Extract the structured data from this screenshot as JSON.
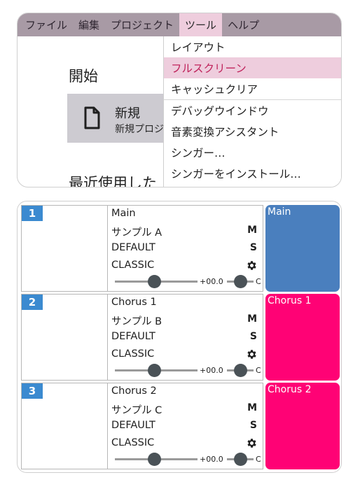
{
  "menubar": {
    "items": [
      "ファイル",
      "編集",
      "プロジェクト",
      "ツール",
      "ヘルプ"
    ],
    "active_index": 3
  },
  "start_page": {
    "heading": "開始",
    "new_card": {
      "title": "新規",
      "subtitle": "新規プロジ",
      "icon": "file-icon"
    },
    "recent_heading": "最近使用した"
  },
  "tools_menu": {
    "items": [
      {
        "label": "レイアウト"
      },
      {
        "label": "フルスクリーン",
        "highlighted": true
      },
      {
        "label": "キャッシュクリア"
      },
      {
        "label": "デバッグウインドウ"
      },
      {
        "label": "音素変換アシスタント"
      },
      {
        "label": "シンガー…"
      },
      {
        "label": "シンガーをインストール…"
      }
    ]
  },
  "colors": {
    "menubar": "#a89aa5",
    "highlight": "#eecddd",
    "highlight_text": "#c0245c",
    "track_number": "#3b8ad0",
    "main_part": "#4a7fbe",
    "chorus_part": "#ff0275"
  },
  "tracks": [
    {
      "number": "1",
      "name": "Main",
      "singer": "サンプル A",
      "phonemizer": "DEFAULT",
      "renderer": "CLASSIC",
      "mute": "M",
      "solo": "S",
      "volume": "+00.0",
      "pan": "C",
      "part_name": "Main",
      "part_color": "#4a7fbe"
    },
    {
      "number": "2",
      "name": "Chorus 1",
      "singer": "サンプル B",
      "phonemizer": "DEFAULT",
      "renderer": "CLASSIC",
      "mute": "M",
      "solo": "S",
      "volume": "+00.0",
      "pan": "C",
      "part_name": "Chorus 1",
      "part_color": "#ff0275"
    },
    {
      "number": "3",
      "name": "Chorus 2",
      "singer": "サンプル C",
      "phonemizer": "DEFAULT",
      "renderer": "CLASSIC",
      "mute": "M",
      "solo": "S",
      "volume": "+00.0",
      "pan": "C",
      "part_name": "Chorus 2",
      "part_color": "#ff0275"
    }
  ]
}
